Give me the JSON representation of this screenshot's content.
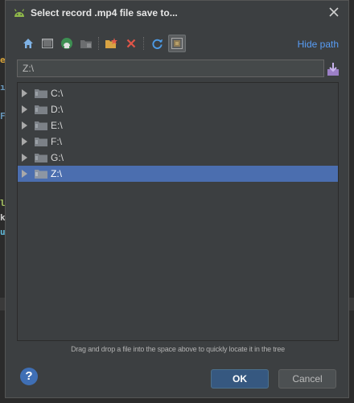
{
  "window": {
    "title": "Select record .mp4 file save to..."
  },
  "toolbar": {
    "buttons": [
      {
        "name": "home-icon"
      },
      {
        "name": "desktop-icon"
      },
      {
        "name": "android-project-icon"
      },
      {
        "name": "module-icon"
      },
      {
        "name": "new-folder-icon"
      },
      {
        "name": "delete-icon"
      },
      {
        "name": "refresh-icon"
      },
      {
        "name": "show-hidden-icon"
      }
    ],
    "hide_path_label": "Hide path"
  },
  "path": {
    "value": "Z:\\"
  },
  "tree": {
    "items": [
      {
        "label": "C:\\",
        "selected": false
      },
      {
        "label": "D:\\",
        "selected": false
      },
      {
        "label": "E:\\",
        "selected": false
      },
      {
        "label": "F:\\",
        "selected": false
      },
      {
        "label": "G:\\",
        "selected": false
      },
      {
        "label": "Z:\\",
        "selected": true
      }
    ]
  },
  "hint_text": "Drag and drop a file into the space above to quickly locate it in the tree",
  "footer": {
    "help_label": "?",
    "ok_label": "OK",
    "cancel_label": "Cancel"
  },
  "colors": {
    "accent": "#589df6",
    "selection": "#4b6eaf",
    "dialog_bg": "#3c3f41"
  }
}
